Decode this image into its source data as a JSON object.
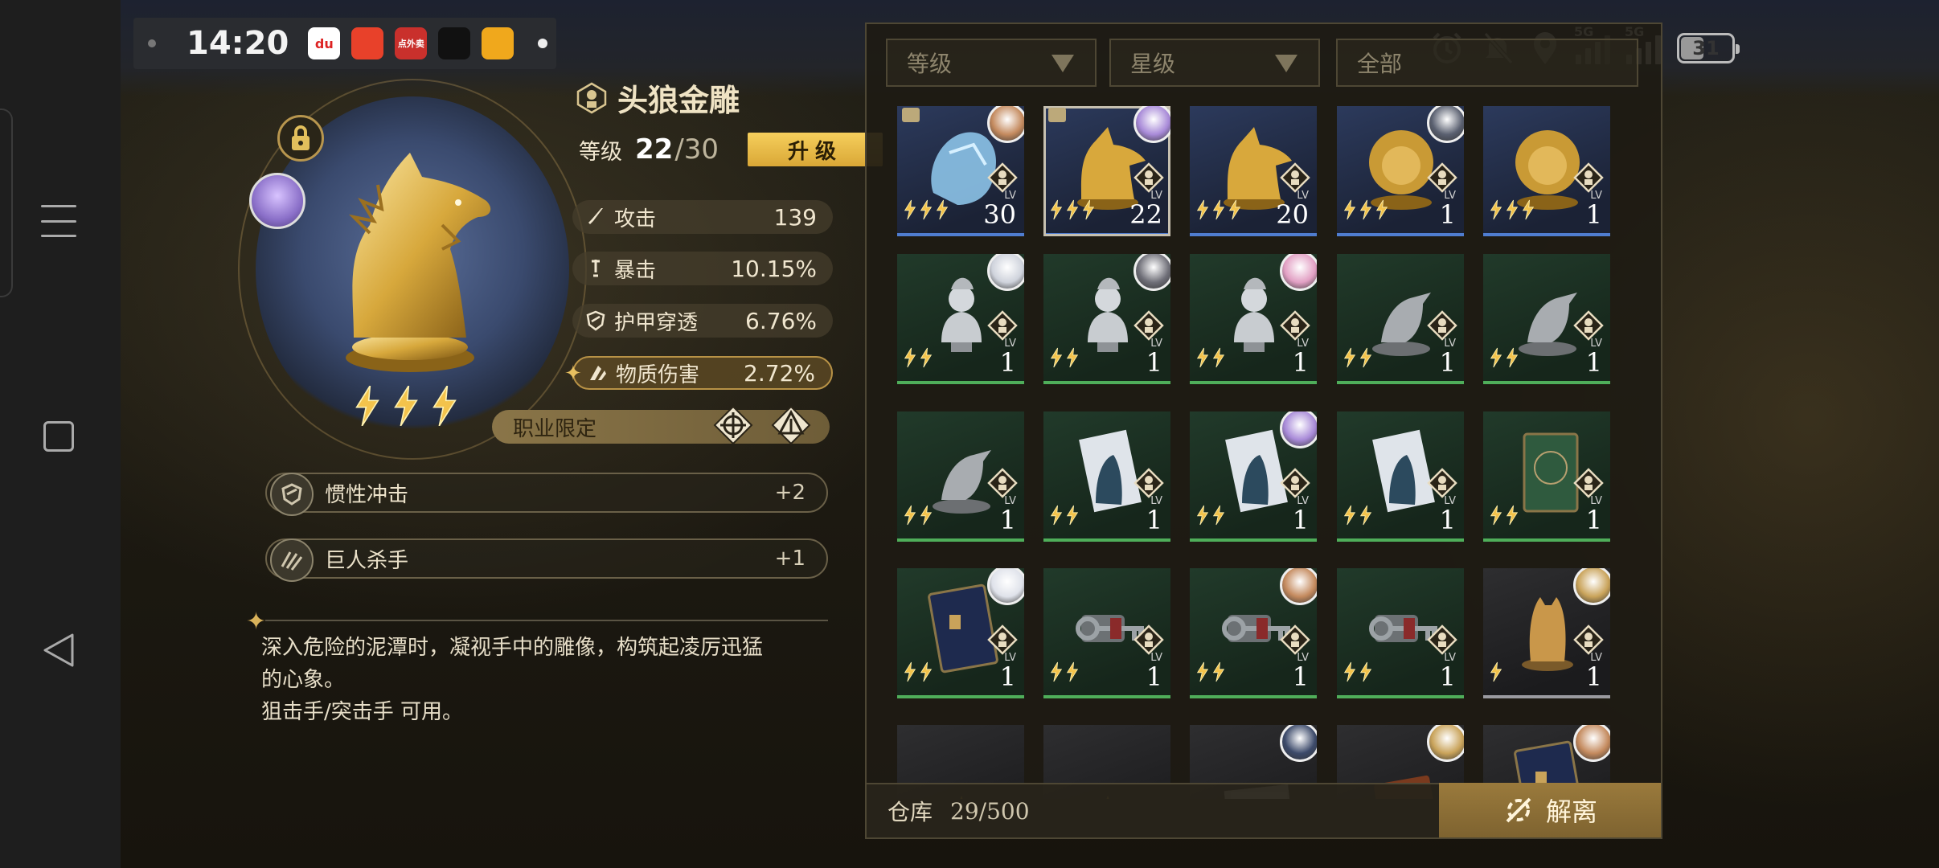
{
  "status_bar": {
    "time": "14:20",
    "apps": [
      {
        "name": "du-icon",
        "label": "du",
        "color": "#ffffff",
        "fg": "#d22"
      },
      {
        "name": "video-app-icon",
        "label": "",
        "color": "#e8412a",
        "fg": "#fff"
      },
      {
        "name": "food-app-icon",
        "label": "点外卖",
        "color": "#c9302c",
        "fg": "#fff"
      },
      {
        "name": "tiktok-icon",
        "label": "",
        "color": "#111111",
        "fg": "#fff"
      },
      {
        "name": "weibo-icon",
        "label": "",
        "color": "#f0a81c",
        "fg": "#d22"
      }
    ],
    "signal1": "5G",
    "signal2": "5G",
    "battery": "31"
  },
  "item": {
    "name": "头狼金雕",
    "level_label": "等级",
    "level": "22",
    "level_max": "/30",
    "upgrade_label": "升级",
    "stats": [
      {
        "icon": "sword-icon",
        "name": "攻击",
        "value": "139"
      },
      {
        "icon": "crit-icon",
        "name": "暴击",
        "value": "10.15%"
      },
      {
        "icon": "armor-pierce-icon",
        "name": "护甲穿透",
        "value": "6.76%"
      },
      {
        "icon": "physical-damage-icon",
        "name": "物质伤害",
        "value": "2.72%"
      }
    ],
    "class_restriction": "职业限定",
    "skills": [
      {
        "icon": "shield-skill-icon",
        "name": "惯性冲击",
        "value": "+2"
      },
      {
        "icon": "claw-skill-icon",
        "name": "巨人杀手",
        "value": "+1"
      }
    ],
    "description_lines": [
      "深入危险的泥潭时，凝视手中的雕像，构筑起凌厉迅猛",
      "的心象。",
      "狙击手/突击手 可用。"
    ],
    "rarity_stars": 3
  },
  "inventory": {
    "filters": [
      {
        "label": "等级"
      },
      {
        "label": "星级"
      },
      {
        "label": "全部"
      }
    ],
    "storage_label": "仓库",
    "storage_value": "29/500",
    "disassemble_label": "解离",
    "lv_label": "LV",
    "items": [
      {
        "kind": "crystal-bust",
        "color": "blue",
        "level": "30",
        "stars": 3,
        "avatar": "#c48a5e",
        "locked": true
      },
      {
        "kind": "wolf-bust",
        "color": "blue",
        "level": "22",
        "stars": 3,
        "avatar": "#a88ad8",
        "locked": true,
        "selected": true
      },
      {
        "kind": "wolf-bust",
        "color": "blue",
        "level": "20",
        "stars": 3
      },
      {
        "kind": "lion-bust",
        "color": "blue",
        "level": "1",
        "stars": 3,
        "avatar": "#5a6070"
      },
      {
        "kind": "lion-bust",
        "color": "blue",
        "level": "1",
        "stars": 3
      },
      {
        "kind": "silver-bust",
        "color": "green",
        "level": "1",
        "stars": 2,
        "avatar": "#cfd3dc"
      },
      {
        "kind": "silver-bust",
        "color": "green",
        "level": "1",
        "stars": 2,
        "avatar": "#6f6f78"
      },
      {
        "kind": "silver-bust",
        "color": "green",
        "level": "1",
        "stars": 2,
        "avatar": "#e2a0c4"
      },
      {
        "kind": "bird-statue",
        "color": "green",
        "level": "1",
        "stars": 2
      },
      {
        "kind": "bird-statue",
        "color": "green",
        "level": "1",
        "stars": 2
      },
      {
        "kind": "bird-statue",
        "color": "green",
        "level": "1",
        "stars": 2
      },
      {
        "kind": "portrait-card",
        "color": "green",
        "level": "1",
        "stars": 2
      },
      {
        "kind": "portrait-card",
        "color": "green",
        "level": "1",
        "stars": 2,
        "avatar": "#a88ad8"
      },
      {
        "kind": "portrait-card",
        "color": "green",
        "level": "1",
        "stars": 2
      },
      {
        "kind": "green-book",
        "color": "green",
        "level": "1",
        "stars": 2
      },
      {
        "kind": "blue-book",
        "color": "green",
        "level": "1",
        "stars": 2,
        "avatar": "#dfe2ea"
      },
      {
        "kind": "key",
        "color": "green",
        "level": "1",
        "stars": 2
      },
      {
        "kind": "key",
        "color": "green",
        "level": "1",
        "stars": 2,
        "avatar": "#c48a5e"
      },
      {
        "kind": "key",
        "color": "green",
        "level": "1",
        "stars": 2
      },
      {
        "kind": "cat-statue",
        "color": "gray",
        "level": "1",
        "stars": 1,
        "avatar": "#c9a35a"
      },
      {
        "kind": "gold-fragment",
        "color": "gray",
        "level": "",
        "stars": 0
      },
      {
        "kind": "gold-fragment",
        "color": "gray",
        "level": "",
        "stars": 0
      },
      {
        "kind": "papers",
        "color": "gray",
        "level": "",
        "stars": 0,
        "avatar": "#3c4a6a"
      },
      {
        "kind": "brown-book",
        "color": "gray",
        "level": "",
        "stars": 0,
        "avatar": "#c9a35a"
      },
      {
        "kind": "blue-book",
        "color": "gray",
        "level": "",
        "stars": 0,
        "avatar": "#c48a5e"
      }
    ]
  }
}
